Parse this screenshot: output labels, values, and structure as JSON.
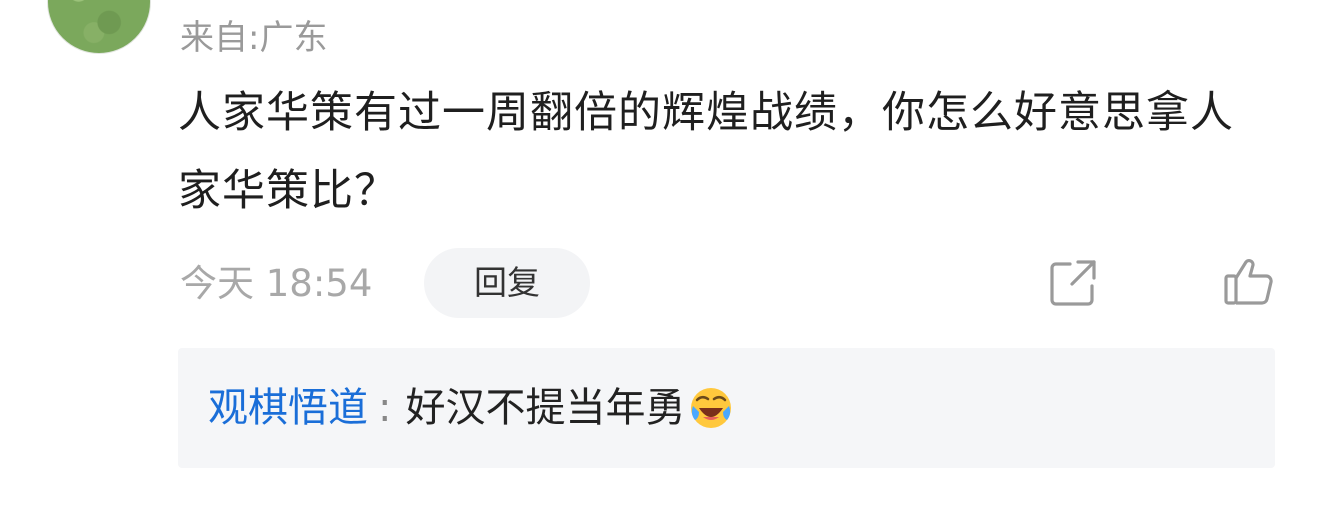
{
  "comment": {
    "location": "来自:广东",
    "text": "人家华策有过一周翻倍的辉煌战绩，你怎么好意思拿人家华策比？",
    "time": "今天 18:54",
    "reply_label": "回复",
    "share_icon": "share-icon",
    "like_icon": "thumbs-up-icon"
  },
  "sub_reply": {
    "user": "观棋悟道",
    "separator": ":",
    "text": "好汉不提当年勇",
    "emoji": "laughing-crying-emoji"
  },
  "colors": {
    "link_blue": "#1a6ed8",
    "muted_gray": "#a8a8a8",
    "reply_bg": "#f5f6f8"
  }
}
